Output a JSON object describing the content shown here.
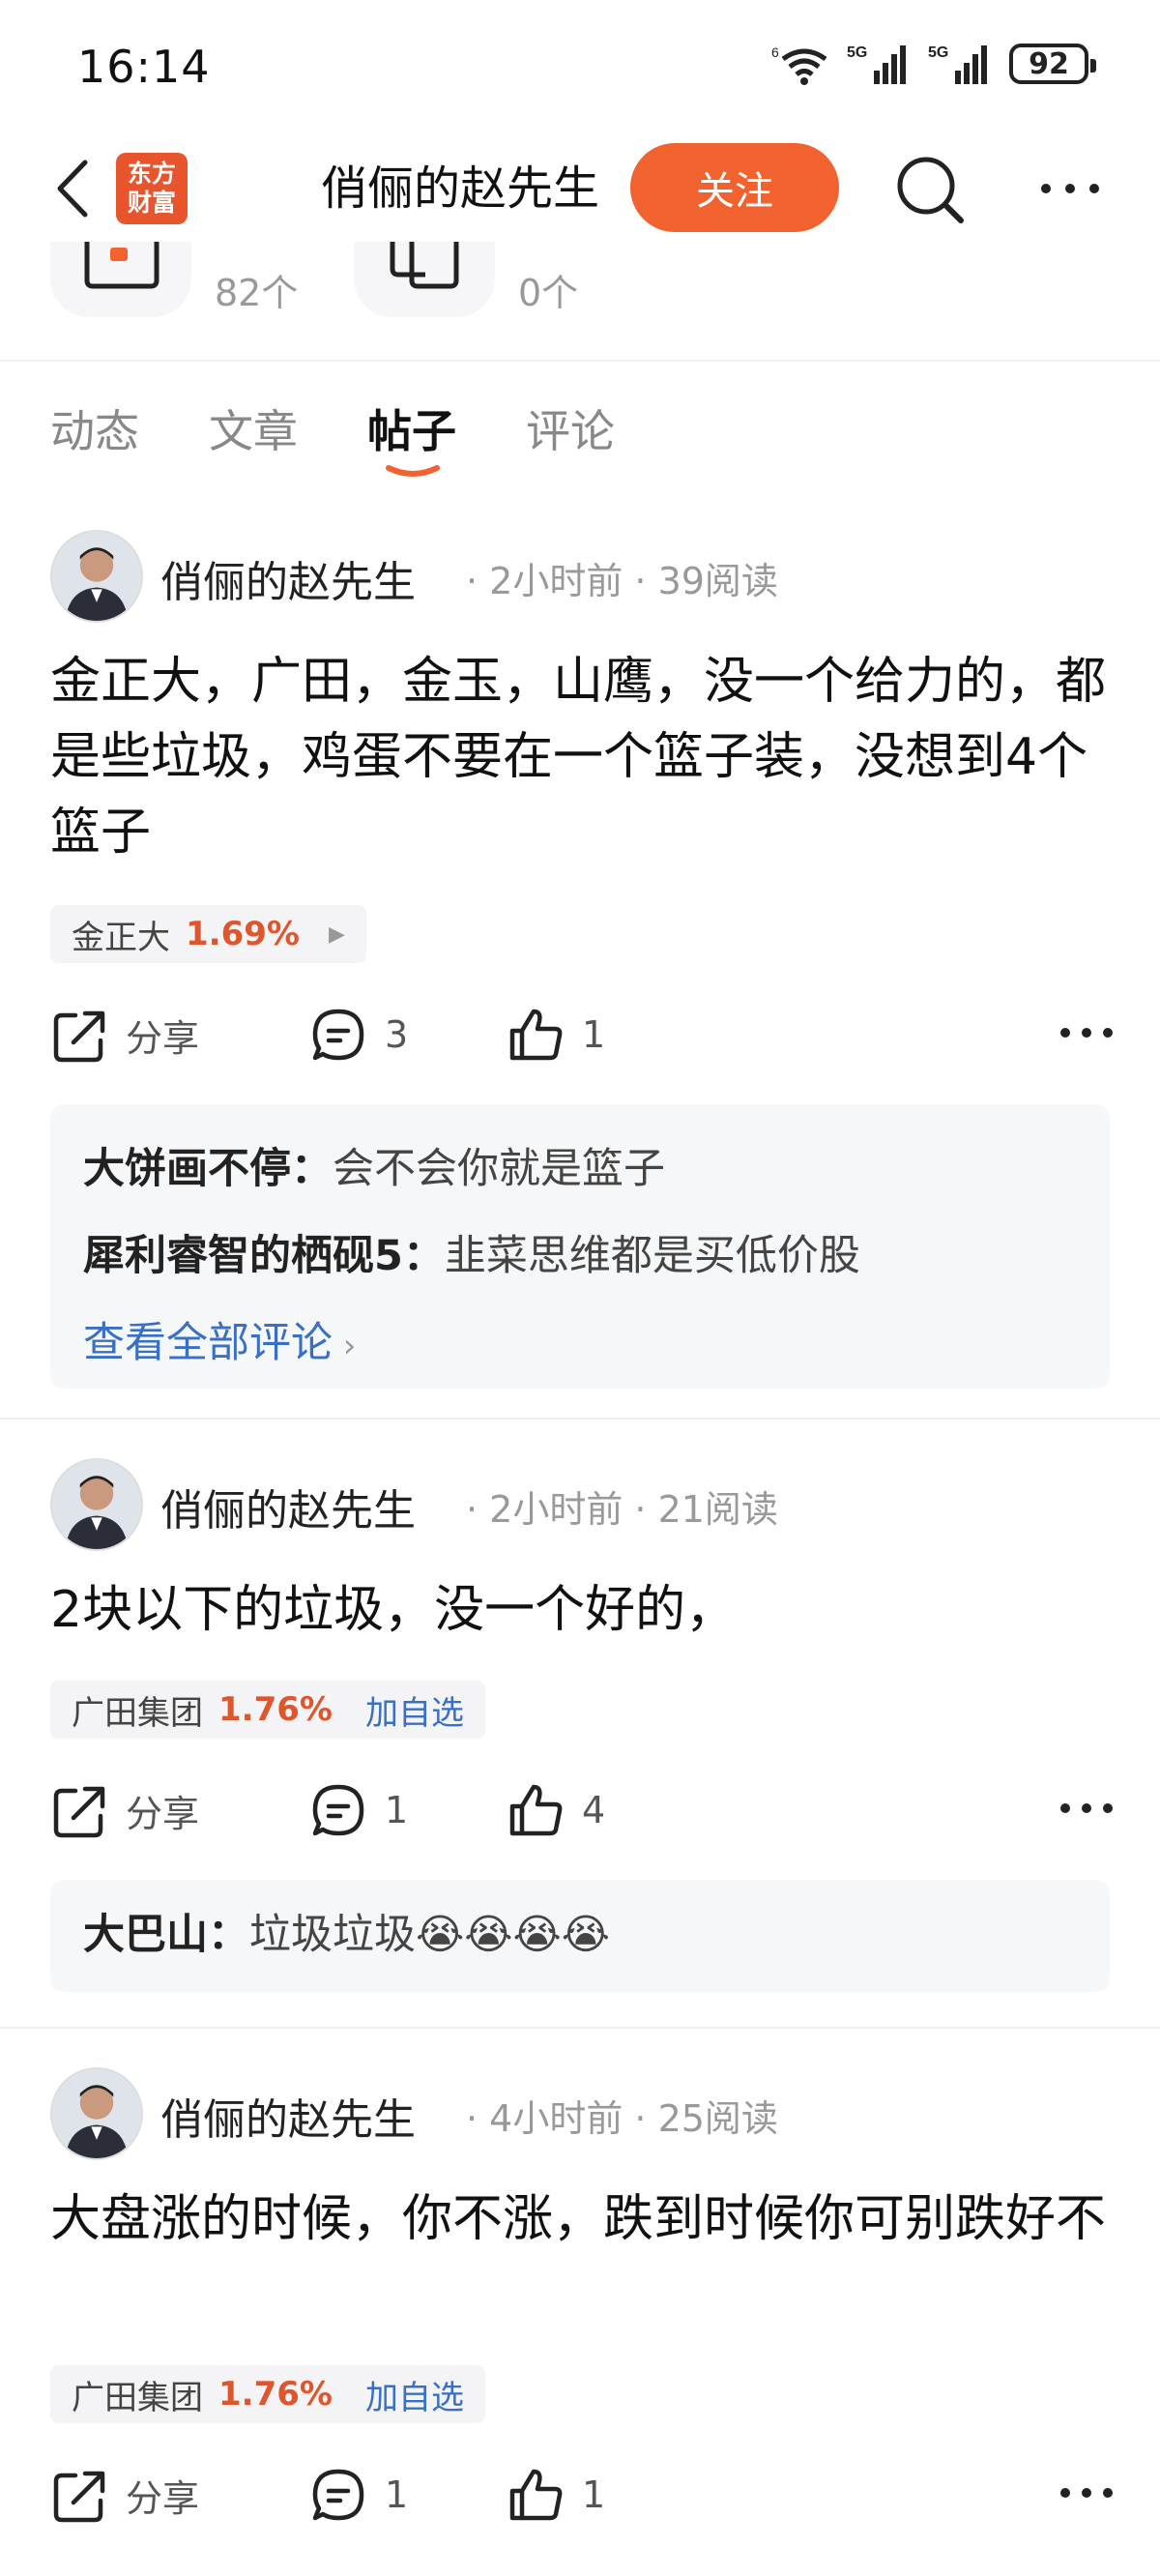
{
  "status_bar": {
    "time": "16:14",
    "battery": "92"
  },
  "nav": {
    "logo_line1": "东方",
    "logo_line2": "财富",
    "title": "俏俪的赵先生",
    "follow_label": "关注"
  },
  "stats": [
    {
      "count": "82个"
    },
    {
      "count": "0个"
    }
  ],
  "tabs": [
    {
      "label": "动态",
      "active": false
    },
    {
      "label": "文章",
      "active": false
    },
    {
      "label": "帖子",
      "active": true
    },
    {
      "label": "评论",
      "active": false
    }
  ],
  "posts": [
    {
      "author": "俏俪的赵先生",
      "meta": "· 2小时前 · 39阅读",
      "text": "金正大，广田，金玉，山鹰，没一个给力的，都是些垃圾，鸡蛋不要在一个篮子装，没想到4个篮子",
      "stock": {
        "name": "金正大",
        "pct": "1.69%"
      },
      "share_label": "分享",
      "comment_count": "3",
      "like_count": "1",
      "comments": [
        {
          "user": "大饼画不停：",
          "text": "会不会你就是篮子"
        },
        {
          "user": "犀利睿智的栖砚5：",
          "text": "韭菜思维都是买低价股"
        }
      ],
      "see_all": "查看全部评论"
    },
    {
      "author": "俏俪的赵先生",
      "meta": "· 2小时前 · 21阅读",
      "text": "2块以下的垃圾，没一个好的，",
      "stock": {
        "name": "广田集团",
        "pct": "1.76%",
        "add": "加自选"
      },
      "share_label": "分享",
      "comment_count": "1",
      "like_count": "4",
      "comments": [
        {
          "user": "大巴山：",
          "text": "垃圾垃圾😭😭😭😭"
        }
      ]
    },
    {
      "author": "俏俪的赵先生",
      "meta": "· 4小时前 · 25阅读",
      "text": "大盘涨的时候，你不涨，跌到时候你可别跌好不",
      "stock": {
        "name": "广田集团",
        "pct": "1.76%",
        "add": "加自选"
      },
      "share_label": "分享",
      "comment_count": "1",
      "like_count": "1"
    }
  ],
  "colors": {
    "accent": "#f2622e",
    "link": "#3a70c4",
    "up": "#e0562c"
  }
}
